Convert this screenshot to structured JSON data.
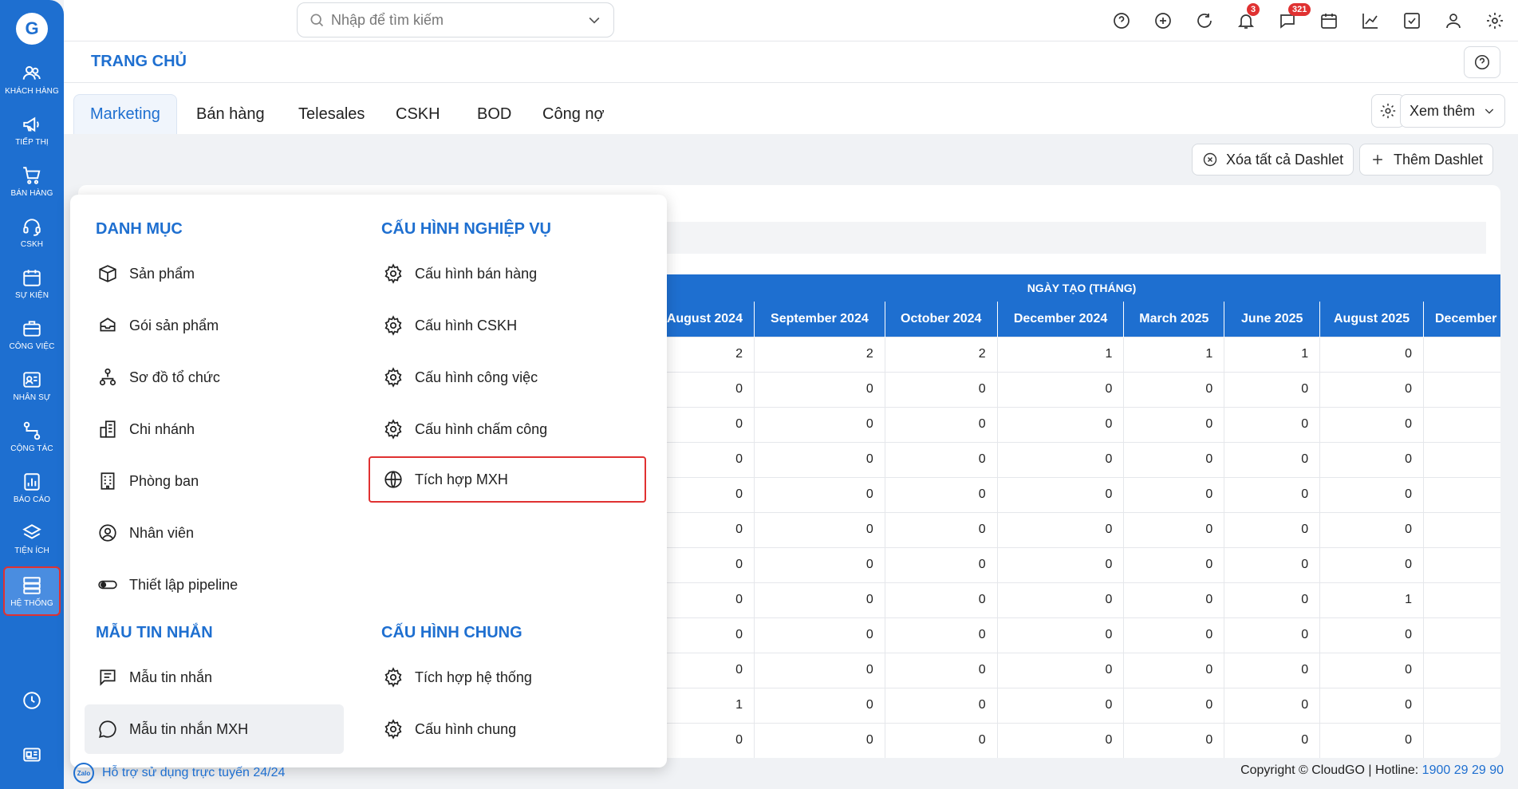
{
  "sidebar": {
    "logo": "G",
    "items": [
      {
        "label": "KHÁCH HÀNG",
        "icon": "users-icon"
      },
      {
        "label": "TIẾP THỊ",
        "icon": "megaphone-icon"
      },
      {
        "label": "BÁN HÀNG",
        "icon": "cart-icon"
      },
      {
        "label": "CSKH",
        "icon": "headset-icon"
      },
      {
        "label": "SỰ KIỆN",
        "icon": "calendar-icon"
      },
      {
        "label": "CÔNG VIỆC",
        "icon": "briefcase-icon"
      },
      {
        "label": "NHÂN SỰ",
        "icon": "id-card-icon"
      },
      {
        "label": "CỘNG TÁC",
        "icon": "workflow-icon"
      },
      {
        "label": "BÁO CÁO",
        "icon": "report-icon"
      },
      {
        "label": "TIỆN ÍCH",
        "icon": "layers-icon"
      },
      {
        "label": "HỆ THỐNG",
        "icon": "server-icon",
        "active": true
      }
    ]
  },
  "search": {
    "placeholder": "Nhập để tìm kiếm"
  },
  "topbar": {
    "notifications_count": "3",
    "messages_count": "321"
  },
  "header": {
    "title": "TRANG CHỦ"
  },
  "tabs": [
    "Marketing",
    "Bán hàng",
    "Telesales",
    "CSKH",
    "BOD",
    "Công nợ"
  ],
  "active_tab": "Marketing",
  "more_button": "Xem thêm",
  "dashlet": {
    "clear_all": "Xóa tất cả Dashlet",
    "add": "Thêm Dashlet"
  },
  "table": {
    "group_header": "NGÀY TẠO (THÁNG)",
    "columns": [
      "August 2024",
      "September 2024",
      "October 2024",
      "December 2024",
      "March 2025",
      "June 2025",
      "August 2025",
      "December"
    ],
    "rows": [
      [
        "2",
        "2",
        "2",
        "1",
        "1",
        "1",
        "0",
        ""
      ],
      [
        "0",
        "0",
        "0",
        "0",
        "0",
        "0",
        "0",
        ""
      ],
      [
        "0",
        "0",
        "0",
        "0",
        "0",
        "0",
        "0",
        ""
      ],
      [
        "0",
        "0",
        "0",
        "0",
        "0",
        "0",
        "0",
        ""
      ],
      [
        "0",
        "0",
        "0",
        "0",
        "0",
        "0",
        "0",
        ""
      ],
      [
        "0",
        "0",
        "0",
        "0",
        "0",
        "0",
        "0",
        ""
      ],
      [
        "0",
        "0",
        "0",
        "0",
        "0",
        "0",
        "0",
        ""
      ],
      [
        "0",
        "0",
        "0",
        "0",
        "0",
        "0",
        "1",
        ""
      ],
      [
        "0",
        "0",
        "0",
        "0",
        "0",
        "0",
        "0",
        ""
      ],
      [
        "0",
        "0",
        "0",
        "0",
        "0",
        "0",
        "0",
        ""
      ],
      [
        "1",
        "0",
        "0",
        "0",
        "0",
        "0",
        "0",
        ""
      ],
      [
        "0",
        "0",
        "0",
        "0",
        "0",
        "0",
        "0",
        ""
      ]
    ]
  },
  "menu": {
    "danh_muc": {
      "title": "DANH MỤC",
      "items": [
        "Sản phẩm",
        "Gói sản phẩm",
        "Sơ đồ tổ chức",
        "Chi nhánh",
        "Phòng ban",
        "Nhân viên",
        "Thiết lập pipeline"
      ]
    },
    "cau_hinh_nghiep_vu": {
      "title": "CẤU HÌNH NGHIỆP VỤ",
      "items": [
        "Cấu hình bán hàng",
        "Cấu hình CSKH",
        "Cấu hình công việc",
        "Cấu hình chấm công",
        "Tích hợp MXH"
      ]
    },
    "mau_tin_nhan": {
      "title": "MẪU TIN NHẮN",
      "items": [
        "Mẫu tin nhắn",
        "Mẫu tin nhắn MXH"
      ]
    },
    "cau_hinh_chung": {
      "title": "CẤU HÌNH CHUNG",
      "items": [
        "Tích hợp hệ thống",
        "Cấu hình chung"
      ]
    }
  },
  "footer": {
    "zalo_label": "Zalo",
    "support": "Hỗ trợ sử dụng trực tuyến 24/24",
    "copyright": "Copyright © CloudGO | Hotline: ",
    "hotline": "1900 29 29 90"
  },
  "colors": {
    "primary": "#1e6fd0",
    "badge": "#e03131",
    "highlight_border": "#e03131"
  }
}
